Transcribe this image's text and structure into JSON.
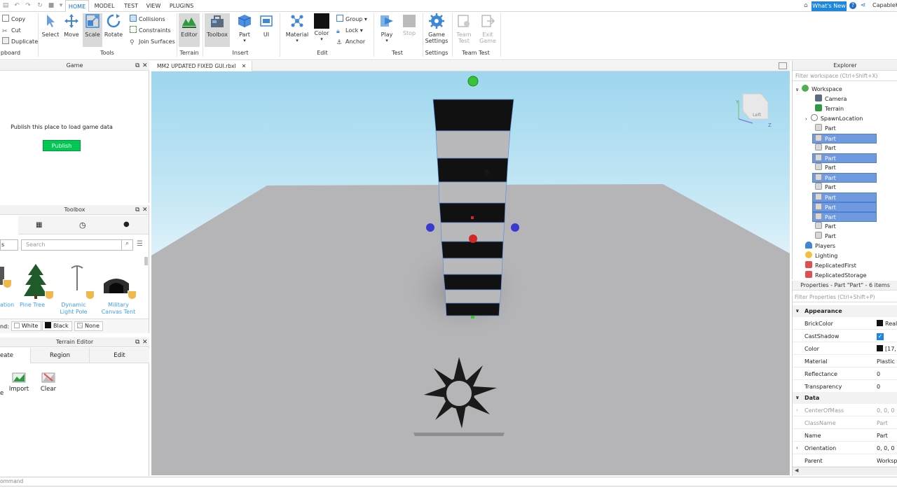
{
  "titlebar": {
    "menu_tabs": [
      "HOME",
      "MODEL",
      "TEST",
      "VIEW",
      "PLUGINS"
    ],
    "active_tab": "HOME",
    "whats_new": "What's New",
    "user": "CapableK"
  },
  "ribbon": {
    "clipboard": {
      "copy": "Copy",
      "cut": "Cut",
      "duplicate": "Duplicate",
      "group": "pboard"
    },
    "tools": {
      "select": "Select",
      "move": "Move",
      "scale": "Scale",
      "rotate": "Rotate",
      "collisions": "Collisions",
      "constraints": "Constraints",
      "join_surfaces": "Join Surfaces",
      "group": "Tools"
    },
    "terrain": {
      "editor": "Editor",
      "group": "Terrain"
    },
    "insert": {
      "toolbox": "Toolbox",
      "part": "Part",
      "ui": "UI",
      "group": "Insert"
    },
    "edit": {
      "material": "Material",
      "color": "Color",
      "group_btn": "Group",
      "lock": "Lock",
      "anchor": "Anchor",
      "group": "Edit"
    },
    "test": {
      "play": "Play",
      "stop": "Stop",
      "group": "Test"
    },
    "settings": {
      "game_settings_1": "Game",
      "game_settings_2": "Settings",
      "group": "Settings"
    },
    "team_test": {
      "team_1": "Team",
      "team_2": "Test",
      "exit_1": "Exit",
      "exit_2": "Game",
      "group": "Team Test"
    }
  },
  "game_panel": {
    "title": "Game",
    "message": "Publish this place to load game data",
    "publish": "Publish"
  },
  "toolbox_panel": {
    "title": "Toolbox",
    "category": "s",
    "search_placeholder": "Search",
    "items": [
      {
        "name": "ation"
      },
      {
        "name": "Pine Tree"
      },
      {
        "name": "Dynamic Light Pole"
      },
      {
        "name": "Military Canvas Tent"
      }
    ],
    "background_label": "nd:",
    "bg_white": "White",
    "bg_black": "Black",
    "bg_none": "None"
  },
  "terrain_panel": {
    "title": "Terrain Editor",
    "tabs": [
      "eate",
      "Region",
      "Edit"
    ],
    "import": "Import",
    "clear": "Clear",
    "e": "e"
  },
  "document_tab": {
    "name": "MM2 UPDATED FIXED GUI.rbxl"
  },
  "viewcube_label": "Left",
  "explorer": {
    "title": "Explorer",
    "filter_placeholder": "Filter workspace (Ctrl+Shift+X)",
    "items": [
      {
        "name": "Workspace",
        "sel": false
      },
      {
        "name": "Camera",
        "sel": false
      },
      {
        "name": "Terrain",
        "sel": false
      },
      {
        "name": "SpawnLocation",
        "sel": false
      },
      {
        "name": "Part",
        "sel": false
      },
      {
        "name": "Part",
        "sel": true
      },
      {
        "name": "Part",
        "sel": false
      },
      {
        "name": "Part",
        "sel": true
      },
      {
        "name": "Part",
        "sel": false
      },
      {
        "name": "Part",
        "sel": true
      },
      {
        "name": "Part",
        "sel": false
      },
      {
        "name": "Part",
        "sel": true
      },
      {
        "name": "Part",
        "sel": true
      },
      {
        "name": "Part",
        "sel": true
      },
      {
        "name": "Part",
        "sel": false
      },
      {
        "name": "Part",
        "sel": false
      },
      {
        "name": "Players",
        "sel": false
      },
      {
        "name": "Lighting",
        "sel": false
      },
      {
        "name": "ReplicatedFirst",
        "sel": false
      },
      {
        "name": "ReplicatedStorage",
        "sel": false
      }
    ]
  },
  "properties": {
    "title": "Properties - Part \"Part\" - 6 items",
    "filter_placeholder": "Filter Properties (Ctrl+Shift+P)",
    "appearance": "Appearance",
    "rows_appearance": [
      {
        "name": "BrickColor",
        "value": "Real"
      },
      {
        "name": "CastShadow",
        "value": "✓"
      },
      {
        "name": "Color",
        "value": "[17, ..."
      },
      {
        "name": "Material",
        "value": "Plastic"
      },
      {
        "name": "Reflectance",
        "value": "0"
      },
      {
        "name": "Transparency",
        "value": "0"
      }
    ],
    "data": "Data",
    "rows_data": [
      {
        "name": "CenterOfMass",
        "value": "0, 0, 0"
      },
      {
        "name": "ClassName",
        "value": "Part"
      },
      {
        "name": "Name",
        "value": "Part"
      },
      {
        "name": "Orientation",
        "value": "0, 0, 0"
      },
      {
        "name": "Parent",
        "value": "Workspa"
      }
    ]
  },
  "command_bar": {
    "placeholder": "ommand"
  },
  "colors": {
    "accent": "#1f86dd",
    "selection": "#6f9ae0",
    "publish": "#00c853"
  }
}
